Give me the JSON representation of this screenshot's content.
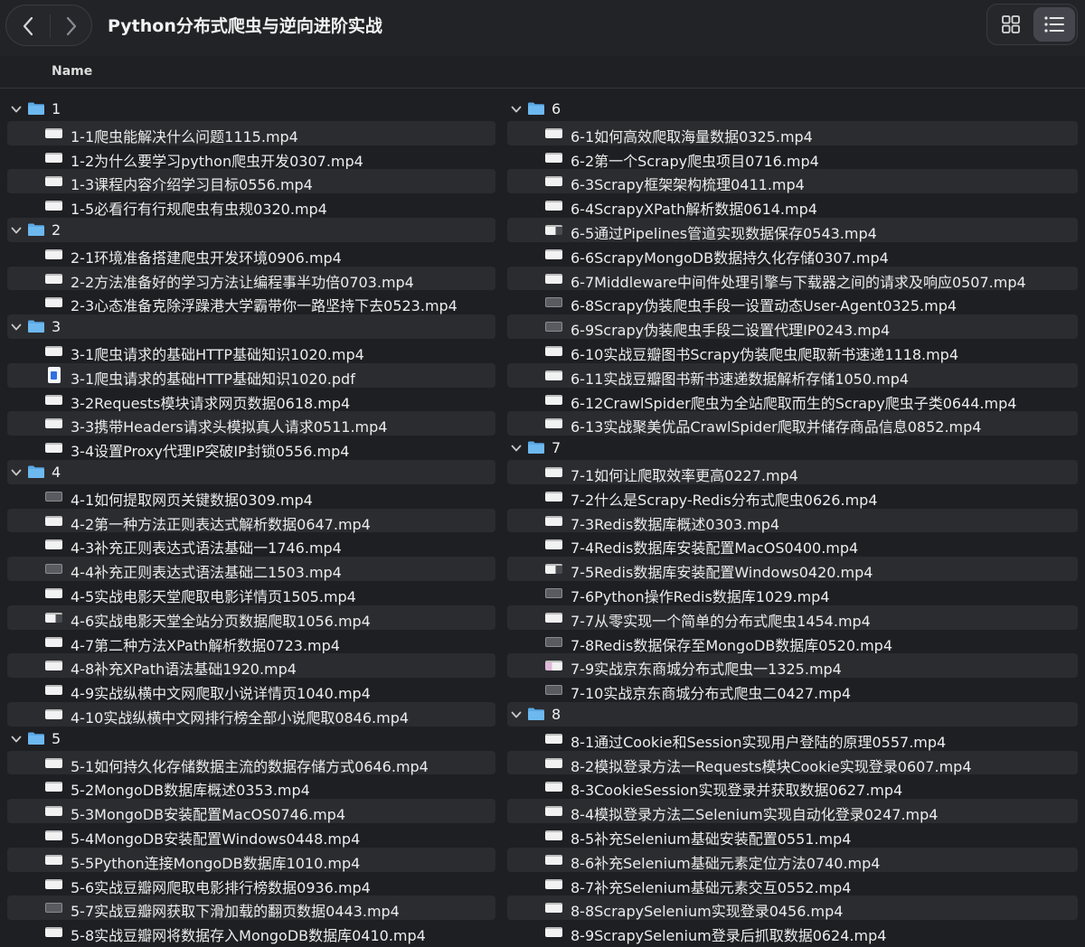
{
  "window": {
    "title": "Python分布式爬虫与逆向进阶实战",
    "header": {
      "name_column": "Name"
    },
    "icons": {
      "back": "chevron-left-icon",
      "forward": "chevron-right-icon",
      "grid_view": "grid-view-icon",
      "list_view": "list-view-icon",
      "folder": "folder-icon",
      "video": "video-file-icon",
      "pdf": "pdf-file-icon"
    },
    "colors": {
      "folder": "#5aa9e6",
      "selected_view": "#45464d",
      "row_stripe": "#2b2c30"
    }
  },
  "columns": [
    {
      "folders": [
        {
          "label": "1",
          "files": [
            {
              "name": "1-1爬虫能解决什么问题1115.mp4",
              "type": "video"
            },
            {
              "name": "1-2为什么要学习python爬虫开发0307.mp4",
              "type": "video"
            },
            {
              "name": "1-3课程内容介绍学习目标0556.mp4",
              "type": "video"
            },
            {
              "name": "1-5必看行有行规爬虫有虫规0320.mp4",
              "type": "video"
            }
          ]
        },
        {
          "label": "2",
          "files": [
            {
              "name": "2-1环境准备搭建爬虫开发环境0906.mp4",
              "type": "video"
            },
            {
              "name": "2-2方法准备好的学习方法让编程事半功倍0703.mp4",
              "type": "video"
            },
            {
              "name": "2-3心态准备克除浮躁港大学霸带你一路坚持下去0523.mp4",
              "type": "video"
            }
          ]
        },
        {
          "label": "3",
          "files": [
            {
              "name": "3-1爬虫请求的基础HTTP基础知识1020.mp4",
              "type": "video"
            },
            {
              "name": "3-1爬虫请求的基础HTTP基础知识1020.pdf",
              "type": "pdf"
            },
            {
              "name": "3-2Requests模块请求网页数据0618.mp4",
              "type": "video"
            },
            {
              "name": "3-3携带Headers请求头模拟真人请求0511.mp4",
              "type": "video"
            },
            {
              "name": "3-4设置Proxy代理IP突破IP封锁0556.mp4",
              "type": "video"
            }
          ]
        },
        {
          "label": "4",
          "files": [
            {
              "name": "4-1如何提取网页关键数据0309.mp4",
              "type": "video-dark"
            },
            {
              "name": "4-2第一种方法正则表达式解析数据0647.mp4",
              "type": "video"
            },
            {
              "name": "4-3补充正则表达式语法基础一1746.mp4",
              "type": "video"
            },
            {
              "name": "4-4补充正则表达式语法基础二1503.mp4",
              "type": "video-dark"
            },
            {
              "name": "4-5实战电影天堂爬取电影详情页1505.mp4",
              "type": "video"
            },
            {
              "name": "4-6实战电影天堂全站分页数据爬取1056.mp4",
              "type": "video-split"
            },
            {
              "name": "4-7第二种方法XPath解析数据0723.mp4",
              "type": "video"
            },
            {
              "name": "4-8补充XPath语法基础1920.mp4",
              "type": "video"
            },
            {
              "name": "4-9实战纵横中文网爬取小说详情页1040.mp4",
              "type": "video"
            },
            {
              "name": "4-10实战纵横中文网排行榜全部小说爬取0846.mp4",
              "type": "video"
            }
          ]
        },
        {
          "label": "5",
          "files": [
            {
              "name": "5-1如何持久化存储数据主流的数据存储方式0646.mp4",
              "type": "video"
            },
            {
              "name": "5-2MongoDB数据库概述0353.mp4",
              "type": "video"
            },
            {
              "name": "5-3MongoDB安装配置MacOS0746.mp4",
              "type": "video"
            },
            {
              "name": "5-4MongoDB安装配置Windows0448.mp4",
              "type": "video"
            },
            {
              "name": "5-5Python连接MongoDB数据库1010.mp4",
              "type": "video"
            },
            {
              "name": "5-6实战豆瓣网爬取电影排行榜数据0936.mp4",
              "type": "video"
            },
            {
              "name": "5-7实战豆瓣网获取下滑加载的翻页数据0443.mp4",
              "type": "video-dark"
            },
            {
              "name": "5-8实战豆瓣网将数据存入MongoDB数据库0410.mp4",
              "type": "video"
            }
          ]
        }
      ]
    },
    {
      "folders": [
        {
          "label": "6",
          "files": [
            {
              "name": "6-1如何高效爬取海量数据0325.mp4",
              "type": "video"
            },
            {
              "name": "6-2第一个Scrapy爬虫项目0716.mp4",
              "type": "video"
            },
            {
              "name": "6-3Scrapy框架架构梳理0411.mp4",
              "type": "video"
            },
            {
              "name": "6-4ScrapyXPath解析数据0614.mp4",
              "type": "video"
            },
            {
              "name": "6-5通过Pipelines管道实现数据保存0543.mp4",
              "type": "video-split"
            },
            {
              "name": "6-6ScrapyMongoDB数据持久化存储0307.mp4",
              "type": "video"
            },
            {
              "name": "6-7Middleware中间件处理引擎与下载器之间的请求及响应0507.mp4",
              "type": "video"
            },
            {
              "name": "6-8Scrapy伪装爬虫手段一设置动态User-Agent0325.mp4",
              "type": "video-dark"
            },
            {
              "name": "6-9Scrapy伪装爬虫手段二设置代理IP0243.mp4",
              "type": "video-dark"
            },
            {
              "name": "6-10实战豆瓣图书Scrapy伪装爬虫爬取新书速递1118.mp4",
              "type": "video"
            },
            {
              "name": "6-11实战豆瓣图书新书速递数据解析存储1050.mp4",
              "type": "video"
            },
            {
              "name": "6-12CrawlSpider爬虫为全站爬取而生的Scrapy爬虫子类0644.mp4",
              "type": "video"
            },
            {
              "name": "6-13实战聚美优品CrawlSpider爬取并储存商品信息0852.mp4",
              "type": "video"
            }
          ]
        },
        {
          "label": "7",
          "files": [
            {
              "name": "7-1如何让爬取效率更高0227.mp4",
              "type": "video"
            },
            {
              "name": "7-2什么是Scrapy-Redis分布式爬虫0626.mp4",
              "type": "video"
            },
            {
              "name": "7-3Redis数据库概述0303.mp4",
              "type": "video"
            },
            {
              "name": "7-4Redis数据库安装配置MacOS0400.mp4",
              "type": "video"
            },
            {
              "name": "7-5Redis数据库安装配置Windows0420.mp4",
              "type": "video-split"
            },
            {
              "name": "7-6Python操作Redis数据库1029.mp4",
              "type": "video-dark"
            },
            {
              "name": "7-7从零实现一个简单的分布式爬虫1454.mp4",
              "type": "video"
            },
            {
              "name": "7-8Redis数据保存至MongoDB数据库0520.mp4",
              "type": "video-dark"
            },
            {
              "name": "7-9实战京东商城分布式爬虫一1325.mp4",
              "type": "video-pink"
            },
            {
              "name": "7-10实战京东商城分布式爬虫二0427.mp4",
              "type": "video-dark"
            }
          ]
        },
        {
          "label": "8",
          "files": [
            {
              "name": "8-1通过Cookie和Session实现用户登陆的原理0557.mp4",
              "type": "video"
            },
            {
              "name": "8-2模拟登录方法一Requests模块Cookie实现登录0607.mp4",
              "type": "video"
            },
            {
              "name": "8-3CookieSession实现登录并获取数据0627.mp4",
              "type": "video"
            },
            {
              "name": "8-4模拟登录方法二Selenium实现自动化登录0247.mp4",
              "type": "video"
            },
            {
              "name": "8-5补充Selenium基础安装配置0551.mp4",
              "type": "video"
            },
            {
              "name": "8-6补充Selenium基础元素定位方法0740.mp4",
              "type": "video"
            },
            {
              "name": "8-7补充Selenium基础元素交互0552.mp4",
              "type": "video"
            },
            {
              "name": "8-8ScrapySelenium实现登录0456.mp4",
              "type": "video"
            },
            {
              "name": "8-9ScrapySelenium登录后抓取数据0624.mp4",
              "type": "video"
            }
          ]
        }
      ]
    }
  ]
}
